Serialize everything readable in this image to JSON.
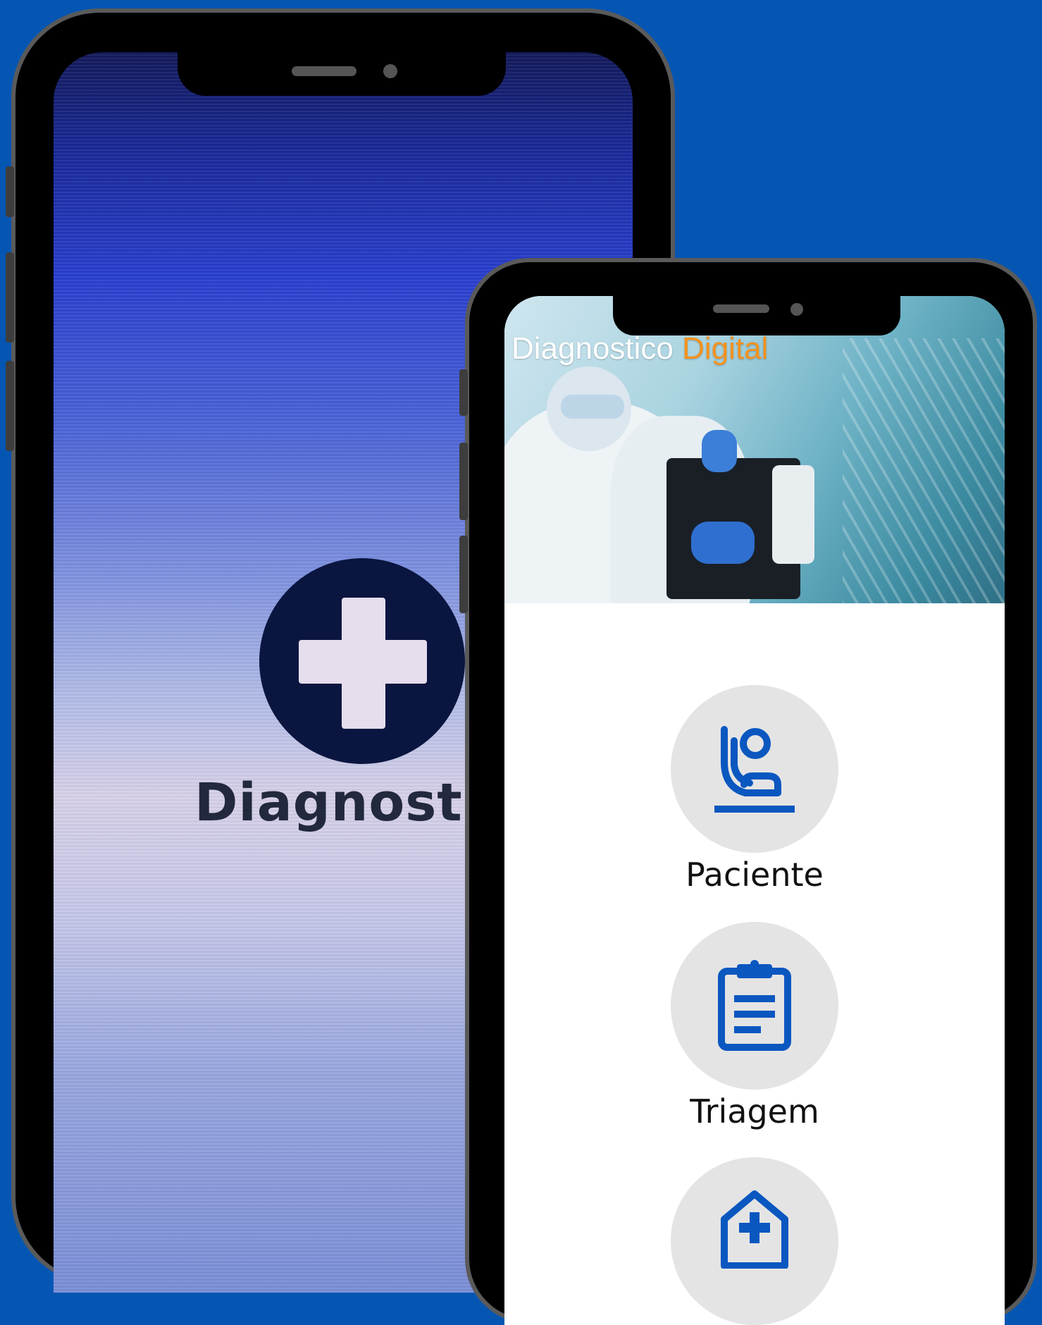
{
  "splash": {
    "logo_text": "Diagnostico"
  },
  "app": {
    "title_primary": "Diagnostico",
    "title_accent": "Digital",
    "accent_color": "#f5921e",
    "icon_color": "#0a57c0"
  },
  "menu": {
    "items": [
      {
        "label": "Paciente",
        "icon": "patient-icon"
      },
      {
        "label": "Triagem",
        "icon": "clipboard-icon"
      },
      {
        "label": "",
        "icon": "hospital-icon"
      }
    ]
  }
}
